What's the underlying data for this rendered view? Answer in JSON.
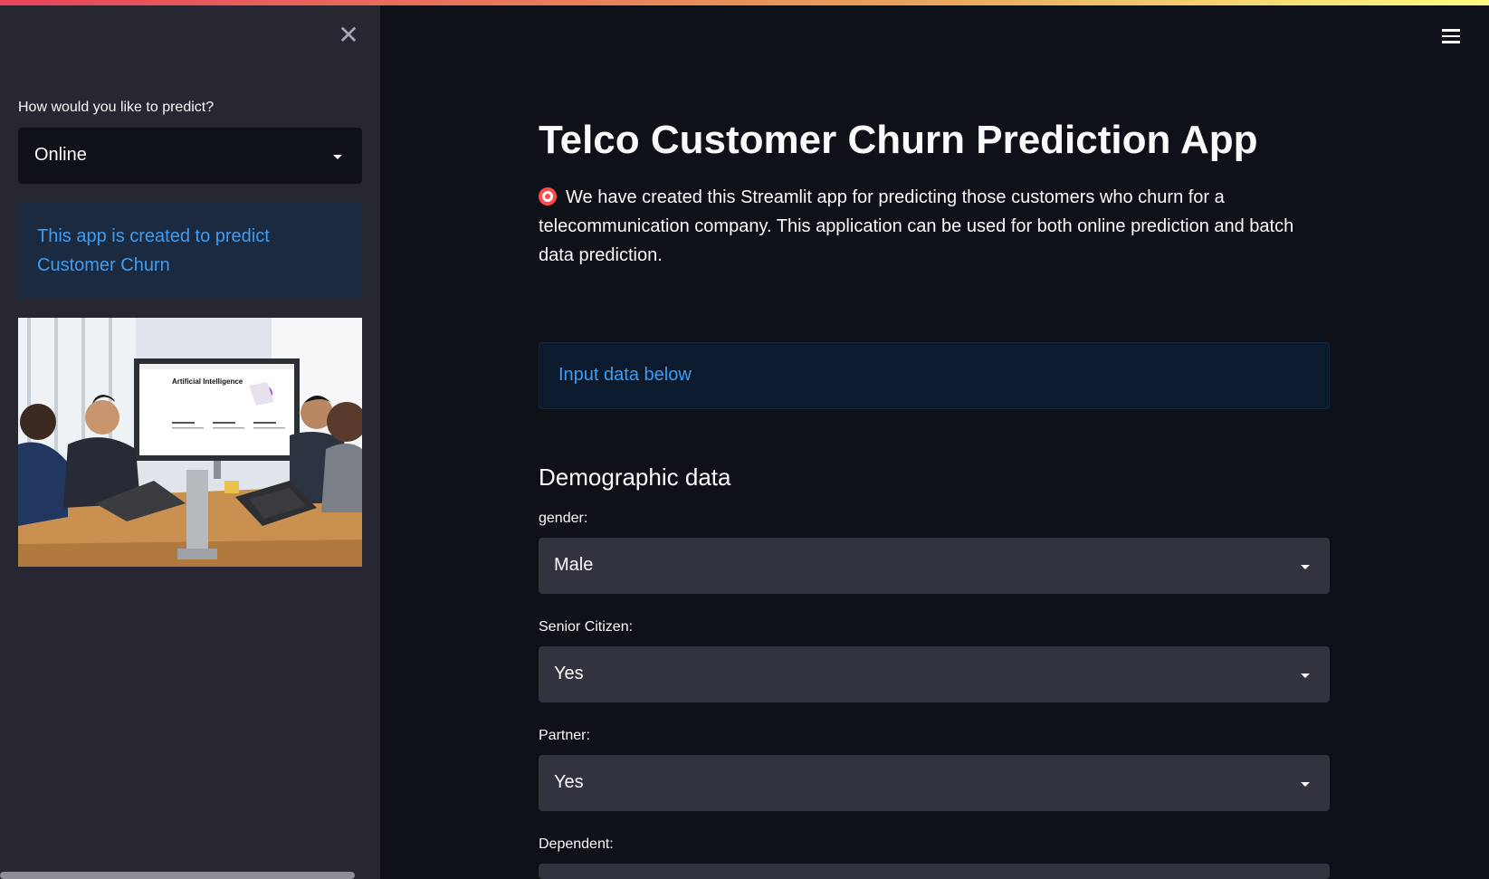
{
  "sidebar": {
    "close_icon": "close-icon",
    "predict_label": "How would you like to predict?",
    "predict_value": "Online",
    "info_text": "This app is created to predict Customer Churn",
    "image_heading": "Artificial Intelligence"
  },
  "header": {
    "menu_icon": "hamburger-menu-icon"
  },
  "main": {
    "title": "Telco Customer Churn Prediction App",
    "intro": "We have created this Streamlit app for predicting those customers who churn for a telecommunication company. This application can be used for both online prediction and batch data prediction.",
    "intro_icon": "dart-target-emoji",
    "input_info": "Input data below",
    "section_title": "Demographic data",
    "fields": [
      {
        "label": "gender:",
        "value": "Male"
      },
      {
        "label": "Senior Citizen:",
        "value": "Yes"
      },
      {
        "label": "Partner:",
        "value": "Yes"
      },
      {
        "label": "Dependent:",
        "value": ""
      }
    ]
  },
  "colors": {
    "background": "#0e1117",
    "sidebar": "#262730",
    "accent_blue": "#3d9df3",
    "select_bg": "#31333f"
  }
}
